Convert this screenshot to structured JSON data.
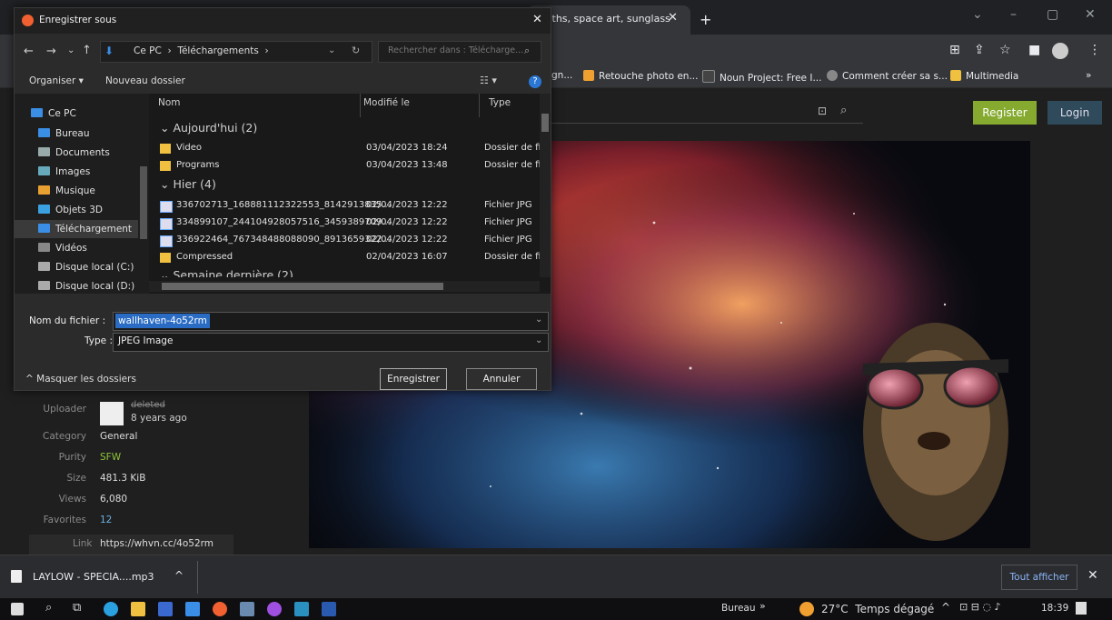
{
  "browser": {
    "tab_title": "sloths, space art, sunglass",
    "tab_close": "✕",
    "new_tab": "+",
    "window_controls": {
      "minimize": "–",
      "maximize": "▢",
      "close": "✕",
      "tabsearch": "⌄"
    },
    "bookmarks": [
      {
        "label": "gn...",
        "color": "#9aa0a6"
      },
      {
        "label": "Retouche photo en...",
        "color": "#f0a030"
      },
      {
        "label": "Noun Project: Free I...",
        "color": "#333"
      },
      {
        "label": "Comment créer sa s...",
        "color": "#aaa"
      },
      {
        "label": "Multimedia",
        "color": "#f0c040"
      }
    ],
    "more_bookmarks": "»"
  },
  "site": {
    "register": "Register",
    "login": "Login",
    "uploader_label": "Uploader",
    "uploader_name": "deleted",
    "uploader_time": "8 years ago",
    "info": [
      {
        "label": "Category",
        "value": "General",
        "color": "#ddd"
      },
      {
        "label": "Purity",
        "value": "SFW",
        "color": "#8fc43a"
      },
      {
        "label": "Size",
        "value": "481.3 KiB",
        "color": "#ddd"
      },
      {
        "label": "Views",
        "value": "6,080",
        "color": "#ddd"
      },
      {
        "label": "Favorites",
        "value": "12",
        "color": "#6ab0e0"
      }
    ],
    "link_label": "Link",
    "link_value": "https://whvn.cc/4o52rm"
  },
  "dialog": {
    "title": "Enregistrer sous",
    "close": "✕",
    "breadcrumb": "Ce PC  ›  Téléchargements  ›",
    "search_placeholder": "Rechercher dans : Télécharge...",
    "organize": "Organiser ▾",
    "new_folder": "Nouveau dossier",
    "nav_items": [
      {
        "label": "Ce PC",
        "color": "#3a8ee6"
      },
      {
        "label": "Bureau",
        "color": "#3a8ee6"
      },
      {
        "label": "Documents",
        "color": "#9aa"
      },
      {
        "label": "Images",
        "color": "#6ab"
      },
      {
        "label": "Musique",
        "color": "#e8a030"
      },
      {
        "label": "Objets 3D",
        "color": "#3aa0e0"
      },
      {
        "label": "Téléchargement",
        "color": "#3a8ee6"
      },
      {
        "label": "Vidéos",
        "color": "#888"
      },
      {
        "label": "Disque local (C:)",
        "color": "#aaa"
      },
      {
        "label": "Disque local (D:)",
        "color": "#aaa"
      }
    ],
    "columns": {
      "name": "Nom",
      "modified": "Modifié le",
      "type": "Type"
    },
    "groups": [
      {
        "label": "Aujourd'hui (2)"
      },
      {
        "label": "Hier (4)"
      },
      {
        "label": "Semaine dernière (2)"
      }
    ],
    "files": [
      {
        "name": "Video",
        "date": "03/04/2023 18:24",
        "type": "Dossier de fic",
        "kind": "folder"
      },
      {
        "name": "Programs",
        "date": "03/04/2023 13:48",
        "type": "Dossier de fic",
        "kind": "folder"
      },
      {
        "name": "336702713_168881112322553_8142913835...",
        "date": "02/04/2023 12:22",
        "type": "Fichier JPG",
        "kind": "jpg"
      },
      {
        "name": "334899107_244104928057516_3459389709...",
        "date": "02/04/2023 12:22",
        "type": "Fichier JPG",
        "kind": "jpg"
      },
      {
        "name": "336922464_767348488088090_8913659322...",
        "date": "02/04/2023 12:22",
        "type": "Fichier JPG",
        "kind": "jpg"
      },
      {
        "name": "Compressed",
        "date": "02/04/2023 16:07",
        "type": "Dossier de fic",
        "kind": "folder"
      }
    ],
    "filename_label": "Nom du fichier :",
    "filename_value": "wallhaven-4o52rm",
    "type_label": "Type :",
    "type_value": "JPEG Image",
    "hide_folders": "Masquer les dossiers",
    "save": "Enregistrer",
    "cancel": "Annuler"
  },
  "download_bar": {
    "file": "LAYLOW - SPECIA....mp3",
    "show_all": "Tout afficher",
    "close": "✕"
  },
  "taskbar": {
    "desktop_label": "Bureau",
    "weather": "27°C  Temps dégagé",
    "time": "18:39"
  }
}
